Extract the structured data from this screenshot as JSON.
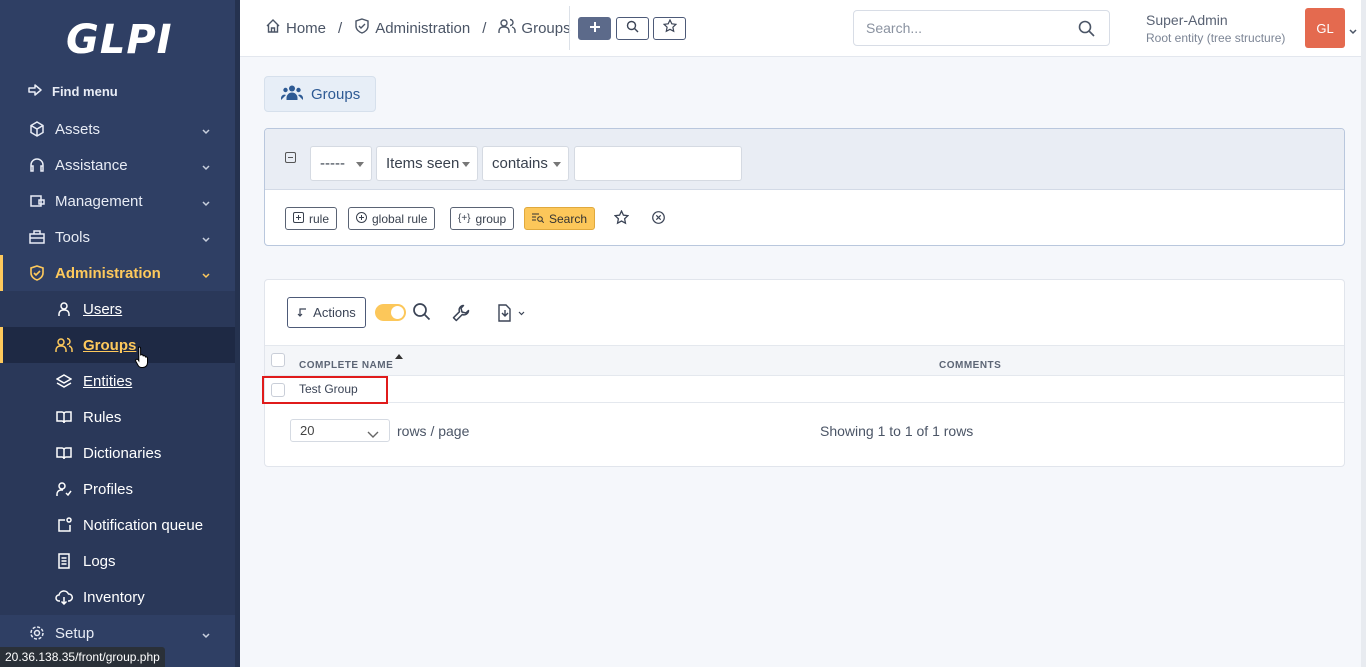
{
  "app": {
    "logo": "GLPI"
  },
  "sidebar": {
    "find_menu": "Find menu",
    "items": [
      {
        "label": "Assets",
        "icon": "cube-icon"
      },
      {
        "label": "Assistance",
        "icon": "headset-icon"
      },
      {
        "label": "Management",
        "icon": "wallet-icon"
      },
      {
        "label": "Tools",
        "icon": "briefcase-icon"
      },
      {
        "label": "Administration",
        "icon": "shield-icon"
      }
    ],
    "subitems": [
      {
        "label": "Users",
        "icon": "user-icon"
      },
      {
        "label": "Groups",
        "icon": "users-icon"
      },
      {
        "label": "Entities",
        "icon": "layers-icon"
      },
      {
        "label": "Rules",
        "icon": "book-icon"
      },
      {
        "label": "Dictionaries",
        "icon": "book-icon"
      },
      {
        "label": "Profiles",
        "icon": "user-check-icon"
      },
      {
        "label": "Notification queue",
        "icon": "notification-icon"
      },
      {
        "label": "Logs",
        "icon": "log-icon"
      },
      {
        "label": "Inventory",
        "icon": "cloud-download-icon"
      }
    ],
    "setup": {
      "label": "Setup",
      "icon": "gear-icon"
    },
    "active_color": "#fec95c"
  },
  "status_bar": {
    "url": "20.36.138.35/front/group.php"
  },
  "topbar": {
    "breadcrumb": [
      {
        "label": "Home",
        "icon": "home-icon"
      },
      {
        "label": "Administration",
        "icon": "shield-icon"
      },
      {
        "label": "Groups",
        "icon": "users-icon"
      }
    ],
    "search_placeholder": "Search...",
    "user_name": "Super-Admin",
    "user_entity": "Root entity (tree structure)",
    "avatar_initials": "GL",
    "avatar_color": "#e46a4f"
  },
  "page": {
    "title": "Groups"
  },
  "criteria": {
    "field_select": "-----",
    "items_select": "Items seen",
    "operator_select": "contains",
    "value": "",
    "buttons": {
      "rule": "rule",
      "global_rule": "global rule",
      "group": "group",
      "search": "Search"
    }
  },
  "results": {
    "actions_label": "Actions",
    "columns": [
      "COMPLETE NAME",
      "COMMENTS"
    ],
    "rows": [
      {
        "name": "Test Group",
        "comments": ""
      }
    ],
    "page_size": "20",
    "rows_per_page_label": "rows / page",
    "showing": "Showing 1 to 1 of 1 rows"
  }
}
